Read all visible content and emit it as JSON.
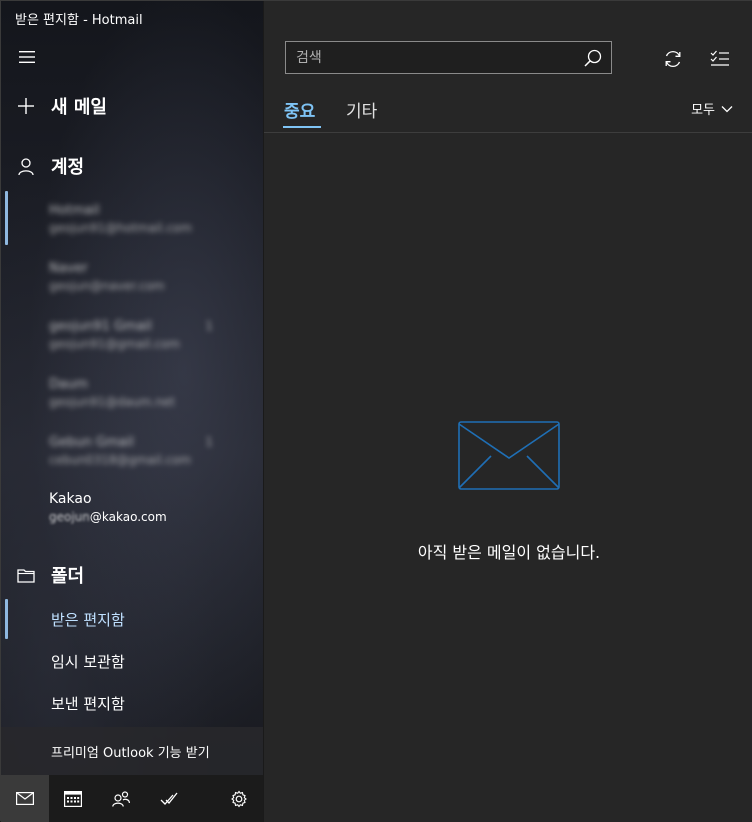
{
  "window": {
    "title": "받은 편지함 - Hotmail"
  },
  "sidebar": {
    "new_mail_label": "새 메일",
    "accounts_heading": "계정",
    "accounts": [
      {
        "name": "Hotmail",
        "email": "geojun91@hotmail.com",
        "count": "",
        "blurred": true
      },
      {
        "name": "Naver",
        "email": "geojun@naver.com",
        "count": "",
        "blurred": true
      },
      {
        "name": "geojun91 Gmail",
        "email": "geojun91@gmail.com",
        "count": "1",
        "blurred": true
      },
      {
        "name": "Daum",
        "email": "geojun91@daum.net",
        "count": "",
        "blurred": true
      },
      {
        "name": "Gebun Gmail",
        "email": "cebun0318@gmail.com",
        "count": "1",
        "blurred": true
      }
    ],
    "kakao_account": {
      "name": "Kakao",
      "email_prefix": "geojun",
      "email_domain": "@kakao.com"
    },
    "folders_heading": "폴더",
    "folders": [
      {
        "label": "받은 편지함",
        "active": true
      },
      {
        "label": "임시 보관함",
        "active": false
      },
      {
        "label": "보낸 편지함",
        "active": false
      }
    ],
    "premium_label": "프리미엄 Outlook 기능 받기"
  },
  "bottom_nav": {
    "items": [
      "mail-icon",
      "calendar-icon",
      "people-icon",
      "todo-icon",
      "settings-icon"
    ]
  },
  "main": {
    "search": {
      "placeholder": "검색",
      "value": ""
    },
    "tabs": [
      {
        "label": "중요",
        "active": true
      },
      {
        "label": "기타",
        "active": false
      }
    ],
    "filter_label": "모두",
    "empty_message": "아직 받은 메일이 없습니다."
  },
  "colors": {
    "accent": "#7fc4f5",
    "envelope": "#1f6fb5",
    "selection_bar": "#8fb8e0"
  }
}
